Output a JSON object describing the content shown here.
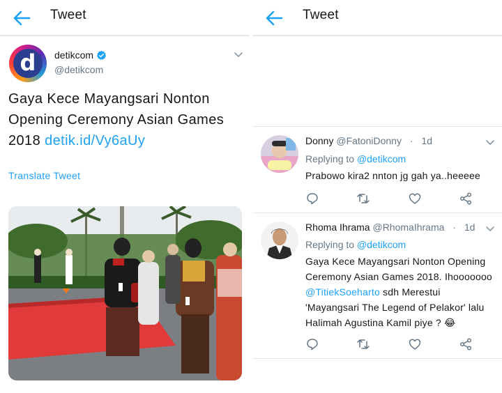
{
  "left": {
    "header": {
      "title": "Tweet"
    },
    "author": {
      "name": "detikcom",
      "handle": "@detikcom",
      "avatar_letter": "d"
    },
    "tweet": {
      "text": "Gaya Kece Mayangsari Nonton Opening Ceremony Asian Games 2018 ",
      "link": "detik.id/Vy6aUy"
    },
    "translate_label": "Translate Tweet"
  },
  "right": {
    "header": {
      "title": "Tweet"
    },
    "replies": [
      {
        "name": "Donny",
        "handle": "@FatoniDonny",
        "sep": "·",
        "time": "1d",
        "replying_prefix": "Replying to ",
        "replying_to": "@detikcom",
        "text": "Prabowo kira2 nnton jg gah ya..heeeee"
      },
      {
        "name": "Rhoma Ihrama",
        "handle": "@RhomaIhrama",
        "sep": "·",
        "time": "1d",
        "replying_prefix": "Replying to ",
        "replying_to": "@detikcom",
        "text_1": "Gaya Kece Mayangsari Nonton Opening Ceremony Asian Games 2018. Ihooooooo ",
        "mention": "@TitiekSoeharto",
        "text_2": " sdh Merestui 'Mayangsari The Legend of Pelakor' lalu Halimah Agustina Kamil piye ? ",
        "emoji": "😂"
      }
    ]
  },
  "colors": {
    "accent": "#1da1f2",
    "muted": "#657786",
    "border": "#e1e8ed",
    "text": "#14171a"
  },
  "icons": [
    "back-arrow-icon",
    "verified-badge-icon",
    "chevron-down-icon",
    "reply-icon",
    "retweet-icon",
    "like-icon",
    "share-icon"
  ]
}
